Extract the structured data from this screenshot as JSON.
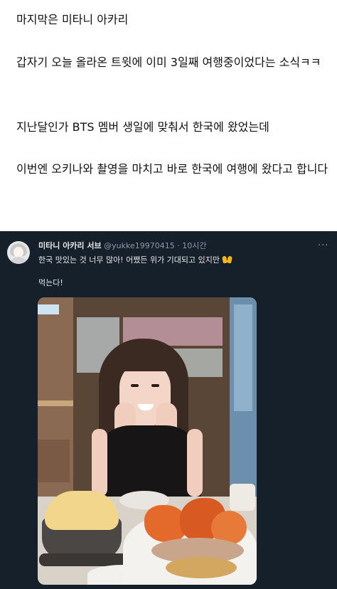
{
  "post": {
    "paragraphs": [
      "마지막은 미타니 아카리",
      "갑자기 오늘 올라온 트윗에 이미 3일째 여행중이었다는 소식ㅋㅋ",
      "지난달인가 BTS 멤버 생일에 맞춰서 한국에 왔었는데",
      "이번엔 오키나와 촬영을 마치고 바로 한국에 여행에 왔다고 합니다"
    ]
  },
  "tweet": {
    "display_name": "미타니 아카리 서브",
    "handle": "@yukke19970415",
    "separator": " · ",
    "time": "10시간",
    "text_line1": "한국 맛있는 것 너무 많아! 어쨌든 위가 기대되고 있지만",
    "text_line2": "먹는다!",
    "emoji": "raised-hands-icon"
  },
  "colors": {
    "tweet_background": "#15202b",
    "tweet_text": "#e7e9ea",
    "tweet_secondary": "#8b98a5",
    "post_text": "#111111"
  }
}
